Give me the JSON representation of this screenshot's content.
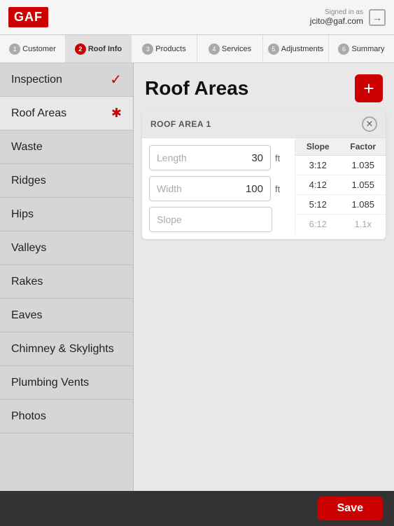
{
  "header": {
    "logo": "GAF",
    "signed_in_label": "Signed in as",
    "email": "jcito@gaf.com",
    "logout_icon": "→"
  },
  "tabs": [
    {
      "number": "1",
      "label": "Customer",
      "active": false
    },
    {
      "number": "2",
      "label": "Roof Info",
      "active": true
    },
    {
      "number": "3",
      "label": "Products",
      "active": false
    },
    {
      "number": "4",
      "label": "Services",
      "active": false
    },
    {
      "number": "5",
      "label": "Adjustments",
      "active": false
    },
    {
      "number": "6",
      "label": "Summary",
      "active": false
    }
  ],
  "sidebar": {
    "items": [
      {
        "label": "Inspection",
        "indicator": "check",
        "active": false
      },
      {
        "label": "Roof Areas",
        "indicator": "star",
        "active": true
      },
      {
        "label": "Waste",
        "indicator": "",
        "active": false
      },
      {
        "label": "Ridges",
        "indicator": "",
        "active": false
      },
      {
        "label": "Hips",
        "indicator": "",
        "active": false
      },
      {
        "label": "Valleys",
        "indicator": "",
        "active": false
      },
      {
        "label": "Rakes",
        "indicator": "",
        "active": false
      },
      {
        "label": "Eaves",
        "indicator": "",
        "active": false
      },
      {
        "label": "Chimney & Skylights",
        "indicator": "",
        "active": false
      },
      {
        "label": "Plumbing Vents",
        "indicator": "",
        "active": false
      },
      {
        "label": "Photos",
        "indicator": "",
        "active": false
      }
    ]
  },
  "content": {
    "title": "Roof Areas",
    "add_button_label": "+",
    "roof_area": {
      "label": "ROOF AREA 1",
      "length_label": "Length",
      "length_value": "30",
      "length_unit": "ft",
      "width_label": "Width",
      "width_value": "100",
      "width_unit": "ft",
      "slope_placeholder": "Slope",
      "slope_table": {
        "col1_header": "Slope",
        "col2_header": "Factor",
        "rows": [
          {
            "slope": "3:12",
            "factor": "1.035"
          },
          {
            "slope": "4:12",
            "factor": "1.055"
          },
          {
            "slope": "5:12",
            "factor": "1.085"
          },
          {
            "slope": "6:12",
            "factor": "1.1x",
            "partial": true
          }
        ]
      }
    }
  },
  "bottom_bar": {
    "save_label": "Save"
  }
}
